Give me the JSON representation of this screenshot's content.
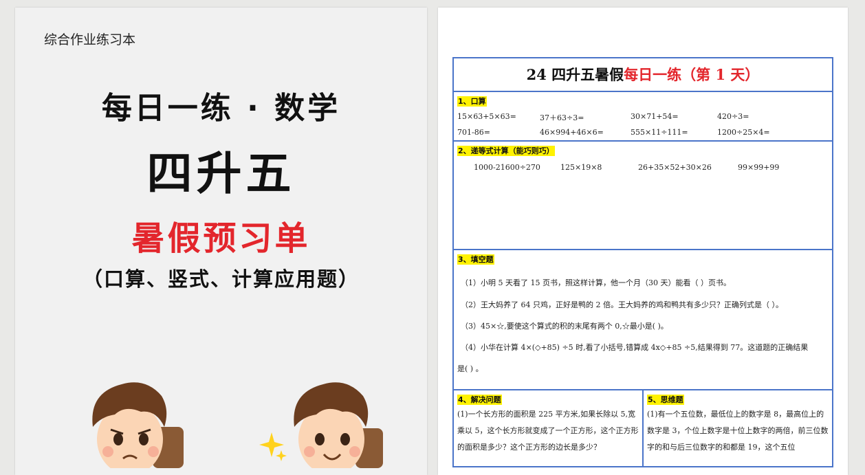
{
  "cover": {
    "brand": "综合作业练习本",
    "title_line1": "每日一练 · 数学",
    "title_line2": "四升五",
    "title_line3": "暑假预习单",
    "subtitle": "（口算、竖式、计算应用题）",
    "accent_color": "#e3262c"
  },
  "sheet": {
    "title_black": "24 四升五暑假",
    "title_red": "每日一练（第 1 天）",
    "sections": {
      "oral": {
        "heading": "1、口算",
        "items": [
          "15×63+5×63=",
          "37＋63÷3=",
          "30×71+54=",
          "420÷3=",
          "701-86=",
          "46×994+46×6=",
          "555×11÷111=",
          "1200÷25×4="
        ]
      },
      "step": {
        "heading": "2、递等式计算（能巧则巧）",
        "items": [
          "1000-21600÷270",
          "125×19×8",
          "26+35×52+30×26",
          "99×99+99"
        ]
      },
      "fill": {
        "heading": "3、填空题",
        "items": [
          "（1）小明 5 天看了 15 页书，照这样计算，他一个月（30 天）能看（  ）页书。",
          "（2）王大妈养了 64 只鸡，正好是鸭的 2 倍。王大妈养的鸡和鸭共有多少只？正确列式是（  ）。",
          "（3）45×☆,要使这个算式的积的末尾有两个 0,☆最小是(      )。",
          "（4）小华在计算 4×(◇+85) ÷5 时,看了小括号,错算成 4x◇+85  ÷5,结果得到 77。这道题的正确结果",
          "是(       ) 。"
        ]
      },
      "solve": {
        "heading": "4、解决问题",
        "text": "(1)一个长方形的面积是 225 平方米,如果长除以 5,宽乘以 5，这个长方形就变成了一个正方形，这个正方形的面积是多少？这个正方形的边长是多少？"
      },
      "thinking": {
        "heading": "5、思维题",
        "text": "(1)有一个五位数，最低位上的数字是 8，最高位上的数字是 3，个位上数字是十位上数字的两倍，前三位数字的和与后三位数字的和都是 19，这个五位"
      }
    }
  }
}
